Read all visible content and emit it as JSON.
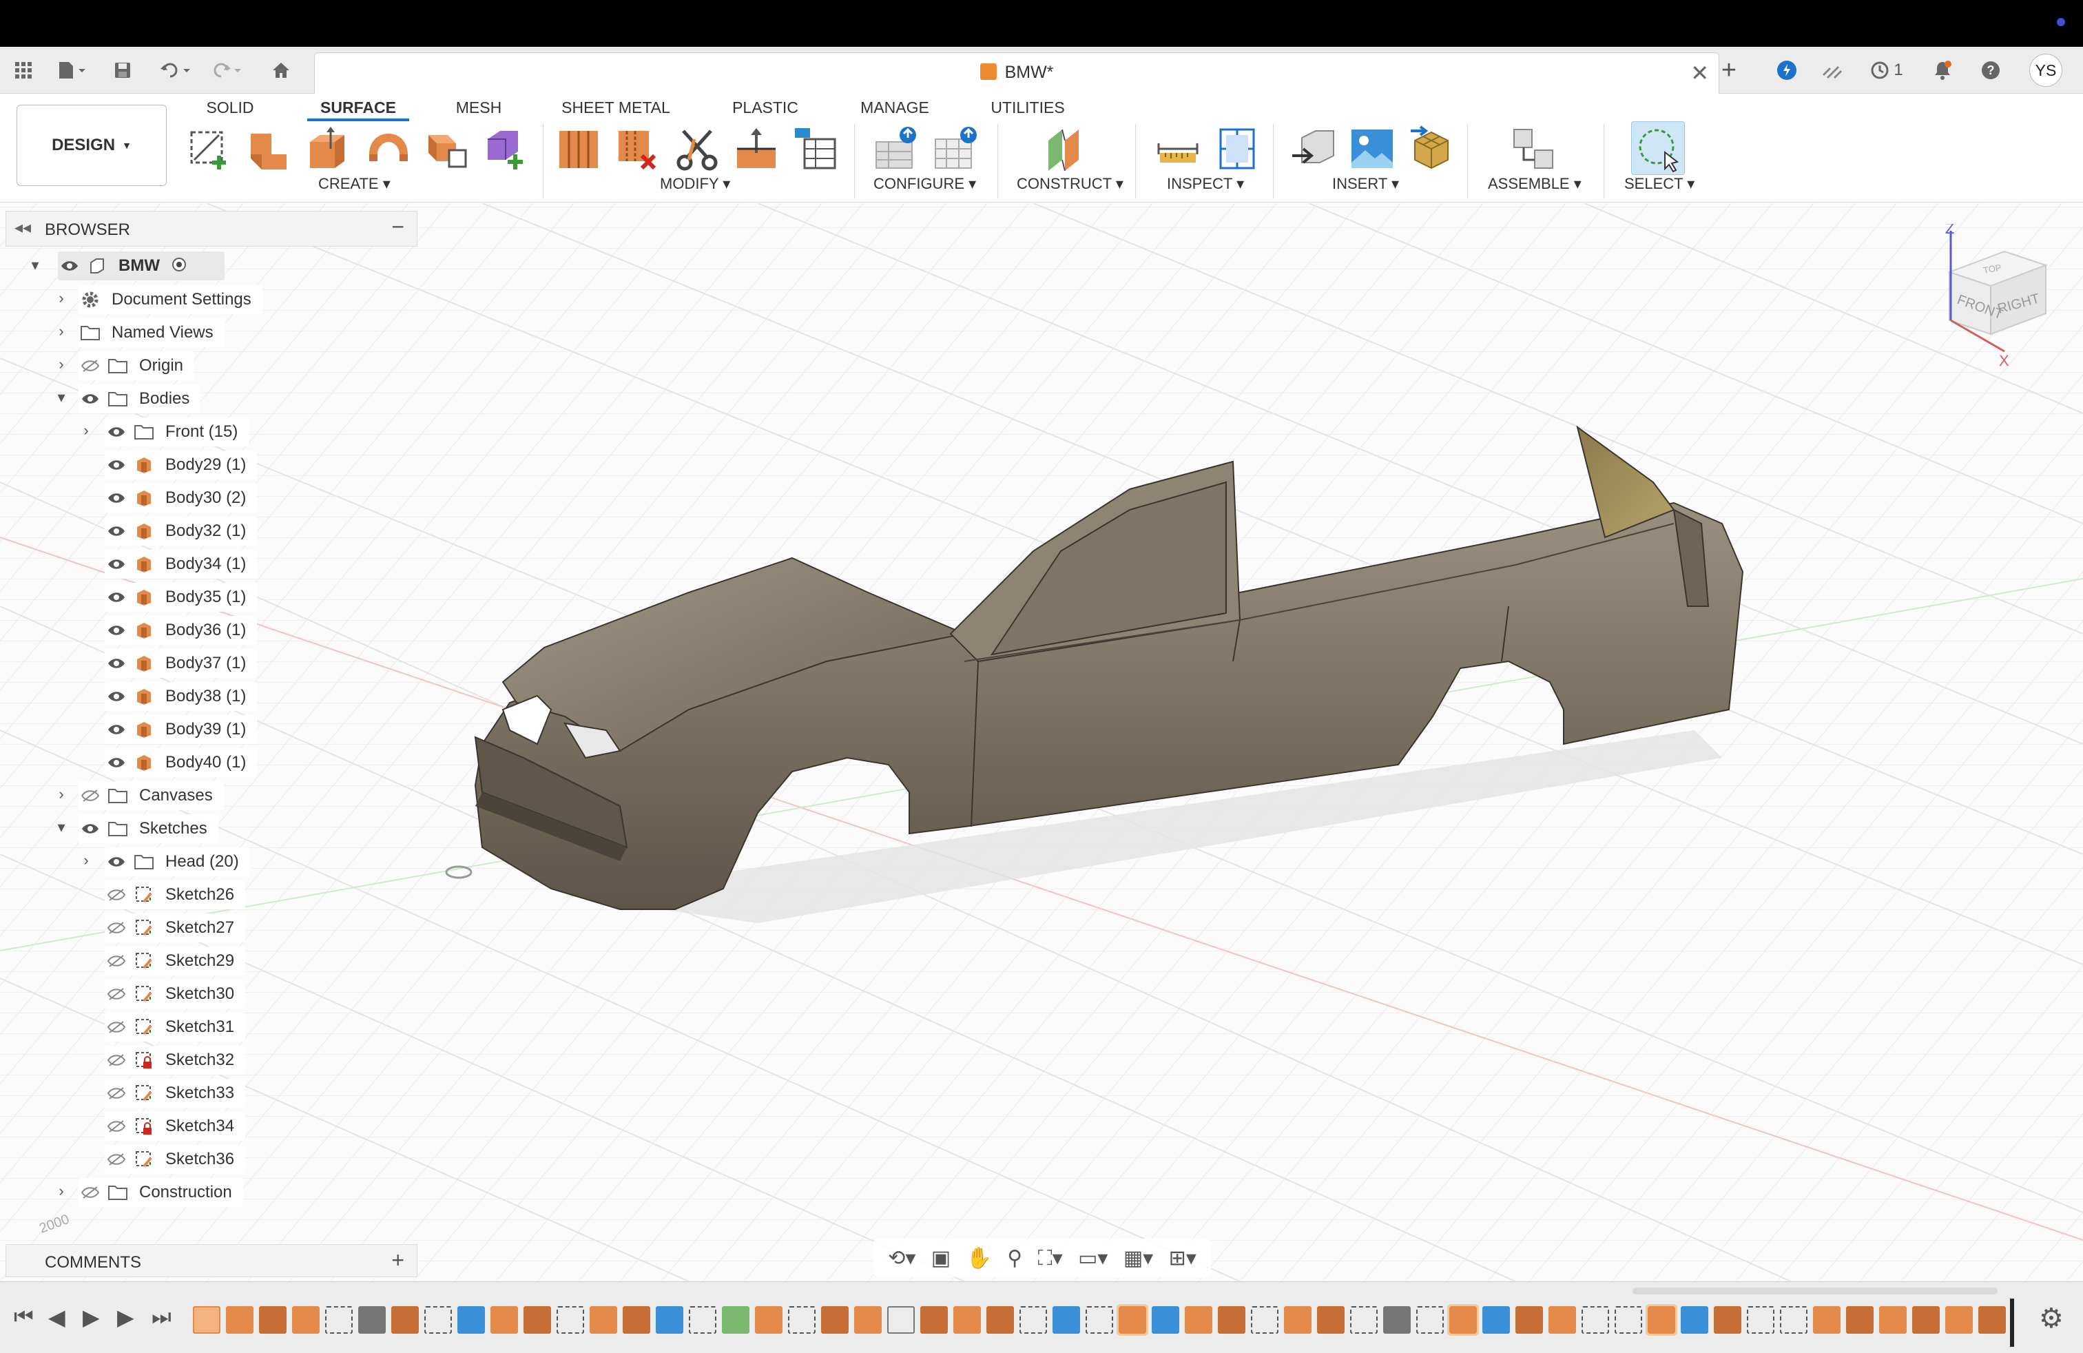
{
  "window": {
    "document_title": "BMW*",
    "user_initials": "YS",
    "job_count": "1"
  },
  "ribbon": {
    "workspace_label": "DESIGN",
    "tabs": [
      {
        "label": "SOLID",
        "active": false
      },
      {
        "label": "SURFACE",
        "active": true
      },
      {
        "label": "MESH",
        "active": false
      },
      {
        "label": "SHEET METAL",
        "active": false
      },
      {
        "label": "PLASTIC",
        "active": false
      },
      {
        "label": "MANAGE",
        "active": false
      },
      {
        "label": "UTILITIES",
        "active": false
      }
    ],
    "groups": {
      "create": "CREATE",
      "modify": "MODIFY",
      "configure": "CONFIGURE",
      "construct": "CONSTRUCT",
      "inspect": "INSPECT",
      "insert": "INSERT",
      "assemble": "ASSEMBLE",
      "select": "SELECT"
    }
  },
  "browser": {
    "title": "BROWSER",
    "root": "BMW",
    "document_settings": "Document Settings",
    "named_views": "Named Views",
    "origin": "Origin",
    "bodies": "Bodies",
    "front_folder": "Front (15)",
    "body_items": [
      "Body29 (1)",
      "Body30 (2)",
      "Body32 (1)",
      "Body34 (1)",
      "Body35 (1)",
      "Body36 (1)",
      "Body37 (1)",
      "Body38 (1)",
      "Body39 (1)",
      "Body40 (1)"
    ],
    "canvases": "Canvases",
    "sketches": "Sketches",
    "head_folder": "Head (20)",
    "sketch_items": [
      "Sketch26",
      "Sketch27",
      "Sketch29",
      "Sketch30",
      "Sketch31",
      "Sketch32",
      "Sketch33",
      "Sketch34",
      "Sketch36"
    ],
    "construction": "Construction"
  },
  "viewcube": {
    "top": "TOP",
    "front": "FRONT",
    "right": "RIGHT",
    "axis_z": "Z",
    "axis_x": "X"
  },
  "viewport": {
    "grid_label": "2000"
  },
  "comments": {
    "title": "COMMENTS"
  },
  "colors": {
    "accent": "#1a73c9",
    "body_orange": "#e3894a",
    "car_surface": "#7c7262"
  }
}
